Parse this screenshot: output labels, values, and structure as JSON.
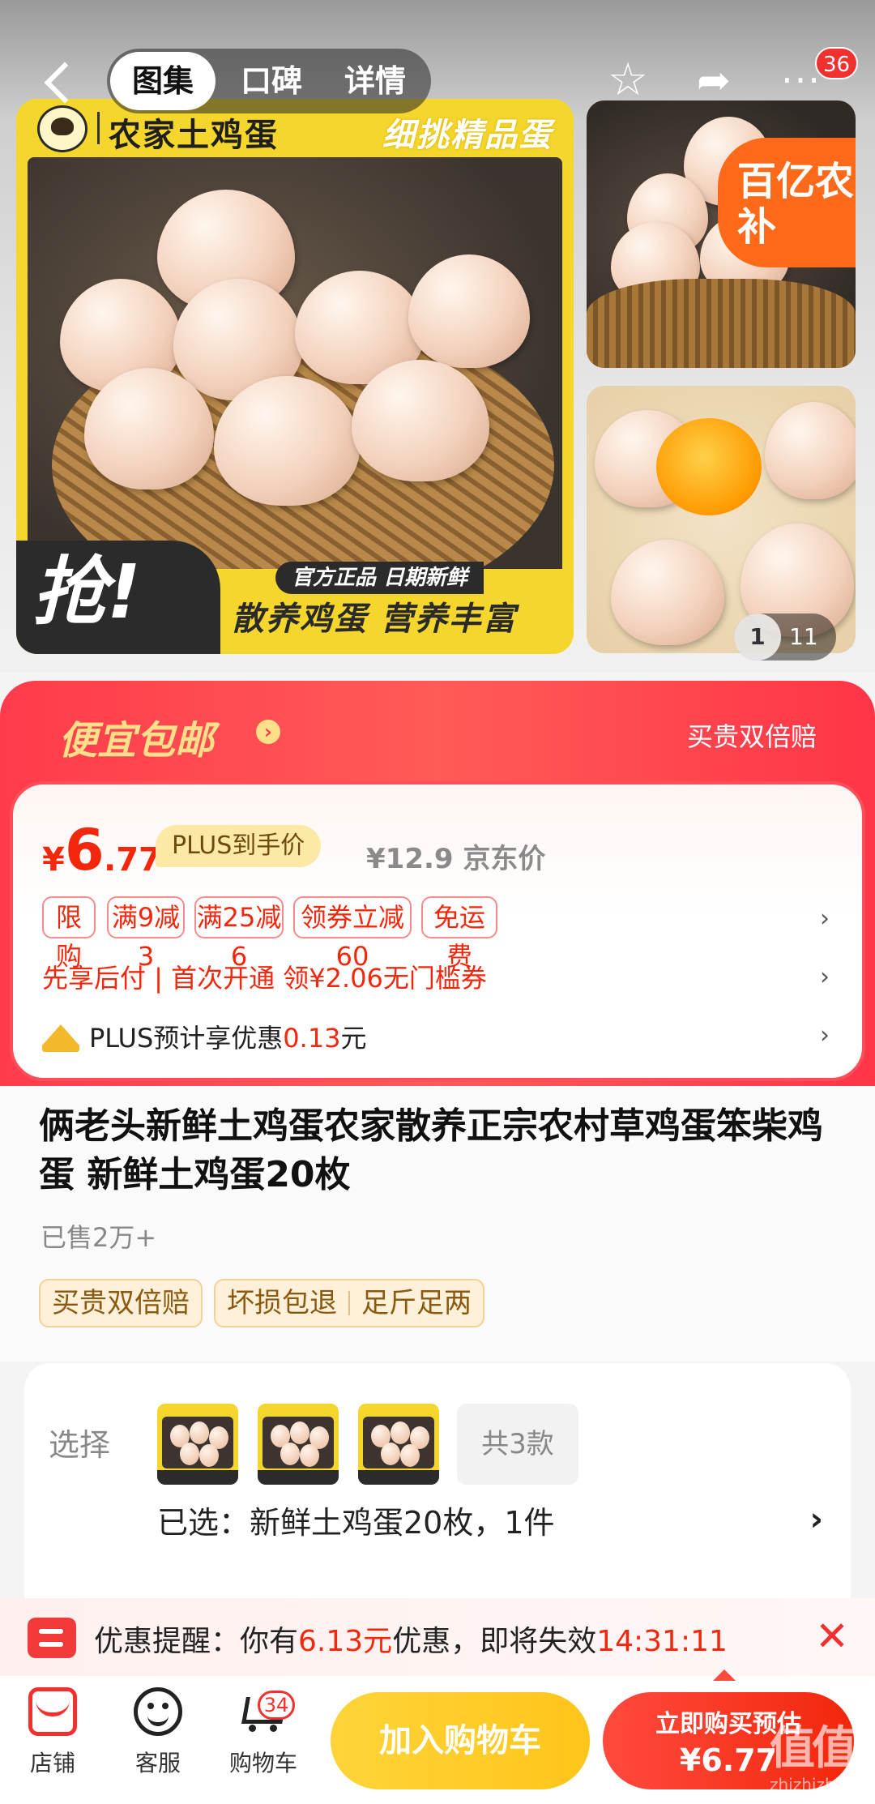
{
  "topbar": {
    "tabs": [
      "图集",
      "口碑",
      "详情"
    ],
    "message_count": "36"
  },
  "gallery": {
    "banner_left": "农家土鸡蛋",
    "banner_right": "细挑精品蛋",
    "grab_text": "抢!",
    "official_tag": "官方正品 日期新鲜",
    "slogan": "散养鸡蛋 营养丰富",
    "subsidy_badge": "百亿农补",
    "counter_current": "1",
    "counter_total": "11"
  },
  "promo": {
    "title": "便宜包邮",
    "arrow": "›",
    "guarantee": "买贵双倍赔"
  },
  "price": {
    "currency": "¥",
    "integer": "6",
    "decimal": ".77",
    "plus_label": "PLUS到手价",
    "jd_price": "¥12.9 京东价",
    "tags": [
      "限购",
      "满9减3",
      "满25减6",
      "领券立减60",
      "免运费"
    ],
    "pay_later": "先享后付 | 首次开通 领¥2.06无门槛券",
    "plus_save_prefix": "PLUS预计享优惠",
    "plus_save_amount": "0.13",
    "plus_save_suffix": "元",
    "chevron": "›"
  },
  "product": {
    "title": "俩老头新鲜土鸡蛋农家散养正宗农村草鸡蛋笨柴鸡蛋 新鲜土鸡蛋20枚",
    "sold": "已售2万+",
    "service_tags": [
      "买贵双倍赔",
      "坏损包退",
      "足斤足两"
    ]
  },
  "select": {
    "label": "选择",
    "variant_count": "共3款",
    "selected": "已选：新鲜土鸡蛋20枚，1件",
    "chevron": "›"
  },
  "reminder": {
    "prefix": "优惠提醒：你有",
    "amount": "6.13元",
    "middle": "优惠，即将失效",
    "countdown": "14:31:11",
    "close": "✕"
  },
  "bottombar": {
    "store": "店铺",
    "service": "客服",
    "cart": "购物车",
    "cart_count": "34",
    "add_to_cart": "加入购物车",
    "buy_now_line1": "立即购买预估",
    "buy_now_line2": "¥6.77"
  },
  "watermark": {
    "text": "值值值",
    "sub": "zhizhizhi.com"
  },
  "colors": {
    "accent_red": "#f2270c",
    "promo_red": "#ff3b4b",
    "cart_yellow": "#ffc51a",
    "banner_yellow": "#f4d62c"
  }
}
